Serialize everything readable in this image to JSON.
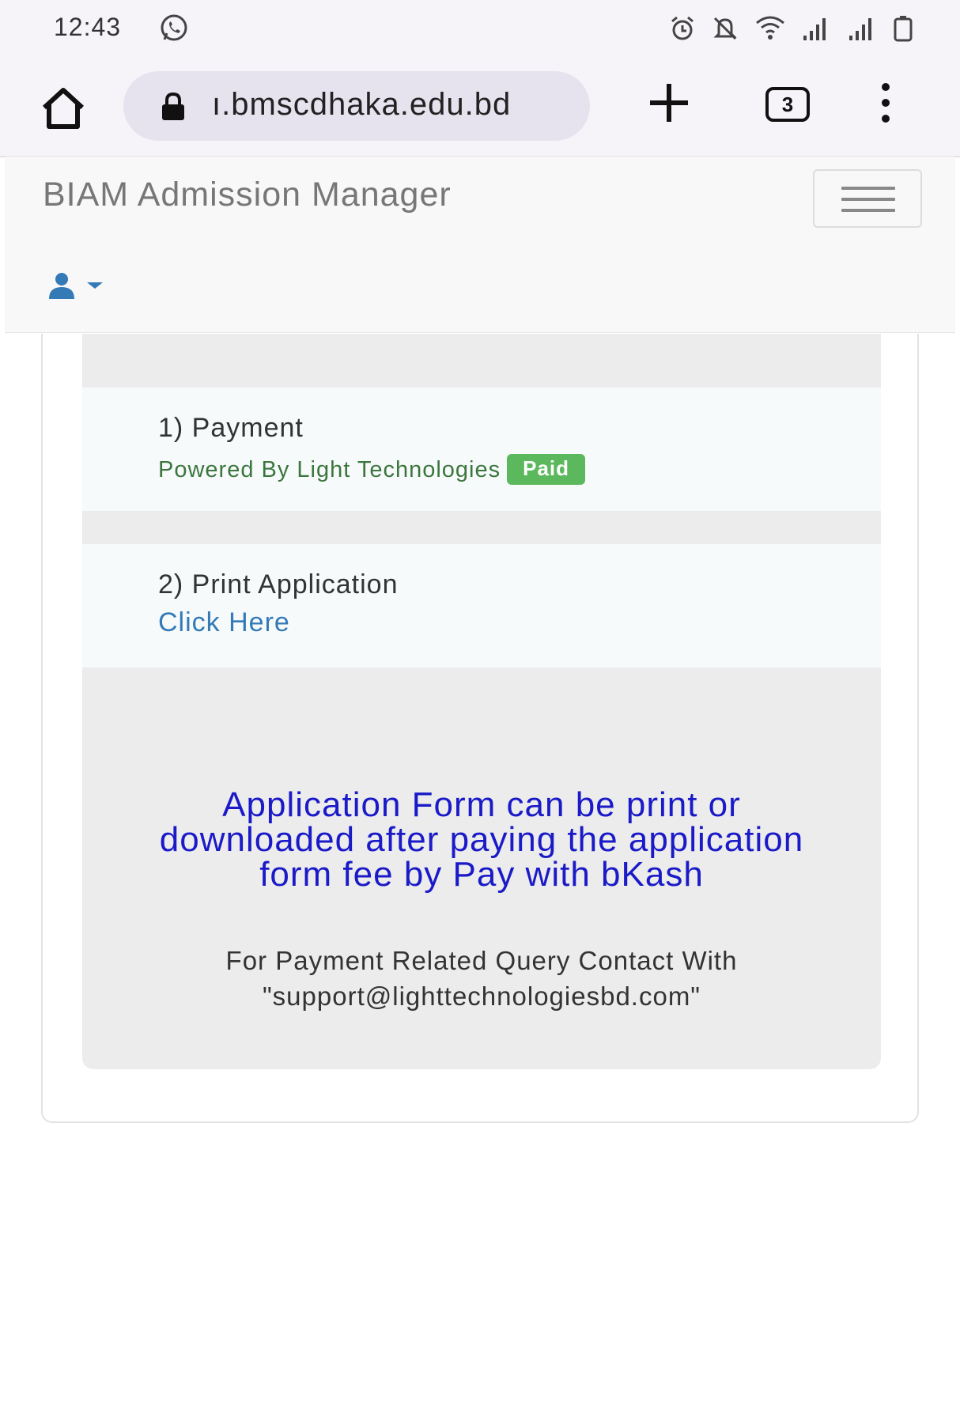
{
  "status_bar": {
    "time": "12:43",
    "icons": [
      "whatsapp-icon",
      "alarm-icon",
      "mute-icon",
      "wifi-icon",
      "signal-icon",
      "signal-icon",
      "battery-icon"
    ]
  },
  "browser": {
    "url": "ı.bmscdhaka.edu.bd",
    "tab_count": "3",
    "icons": [
      "home-icon",
      "lock-icon",
      "plus-icon",
      "more-vert-icon"
    ]
  },
  "navbar": {
    "brand": "BIAM Admission Manager",
    "icons": [
      "hamburger-icon",
      "user-icon",
      "caret-down-icon"
    ]
  },
  "steps": [
    {
      "title": "1) Payment",
      "subtitle": "Powered By Light Technologies",
      "badge": "Paid"
    },
    {
      "title": "2) Print Application",
      "link": "Click Here"
    }
  ],
  "notice": "Application Form can be print or downloaded after paying the application form fee by Pay with bKash",
  "contact": {
    "line1": "For Payment Related Query Contact With",
    "line2": "\"support@lighttechnologiesbd.com\""
  },
  "colors": {
    "notice_text": "#1a1ac8",
    "paid_badge": "#5cb85c",
    "link": "#337ab7",
    "subtitle": "#3c763d",
    "user_icon": "#337ab7"
  }
}
